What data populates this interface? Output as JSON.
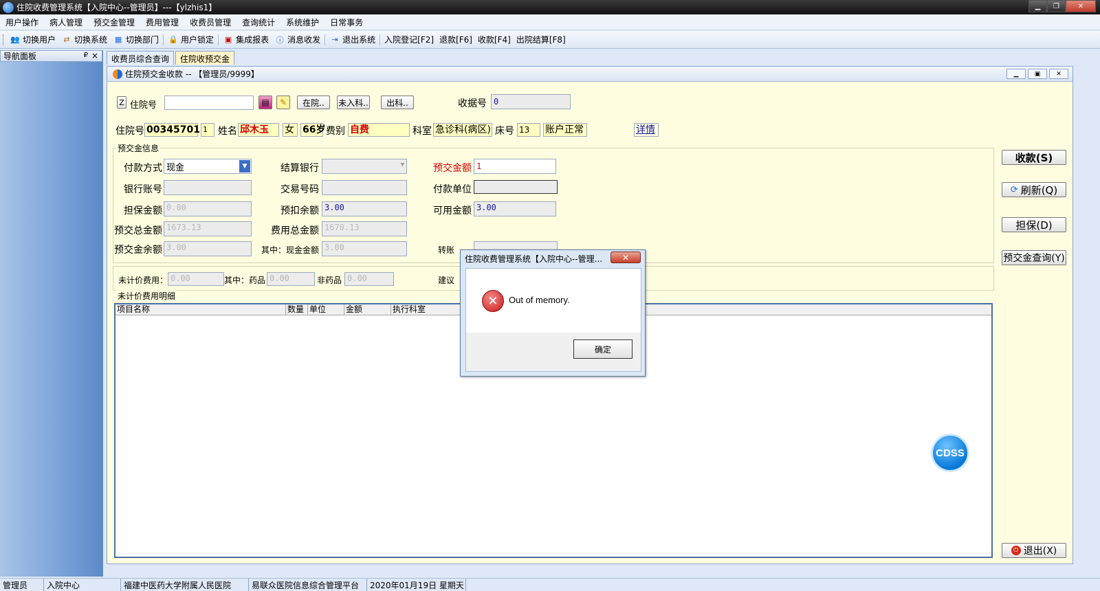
{
  "window": {
    "title": "住院收费管理系统【入院中心--管理员】---【ylzhis1】"
  },
  "menu": [
    "用户操作",
    "病人管理",
    "预交金管理",
    "费用管理",
    "收费员管理",
    "查询统计",
    "系统维护",
    "日常事务"
  ],
  "toolbar": {
    "switch_user": "切换用户",
    "switch_system": "切换系统",
    "switch_dept": "切换部门",
    "user_lock": "用户锁定",
    "integrated_report": "集成报表",
    "message": "消息收发",
    "exit_system": "退出系统",
    "admission": "入院登记[F2]",
    "refund": "退款[F6]",
    "charge": "收款[F4]",
    "discharge": "出院结算[F8]"
  },
  "nav": {
    "title": "导航面板",
    "pin": "₽",
    "close": "×"
  },
  "tabs": [
    "收费员综合查询",
    "住院收预交金"
  ],
  "form": {
    "title": "住院预交金收款 -- 【管理员/9999】",
    "z_label": "Z",
    "inpatient_no_label": "住院号",
    "inpatient_no_value": "",
    "btn_in_hospital": "在院..",
    "btn_not_admitted": "未入科..",
    "btn_discharged": "出科..",
    "receipt_label": "收据号",
    "receipt_value": "0",
    "patient": {
      "id_label": "住院号",
      "id": "00345701",
      "seq": "1",
      "name_label": "姓名",
      "name": "邱木玉",
      "gender": "女",
      "age": "66岁",
      "fee_type_label": "费别",
      "fee_type": "自费",
      "dept_label": "科室",
      "dept": "急诊科(病区)",
      "bed_label": "床号",
      "bed": "13",
      "account_status": "账户正常",
      "detail_link": "详情"
    },
    "deposit_group": "预交金信息",
    "pay_method_label": "付款方式",
    "pay_method": "现金",
    "settle_bank_label": "结算银行",
    "settle_bank": "",
    "deposit_amount_label": "预交金额",
    "deposit_amount": "1",
    "bank_account_label": "银行账号",
    "bank_account": "",
    "trade_no_label": "交易号码",
    "trade_no": "",
    "payer_unit_label": "付款单位",
    "payer_unit": "",
    "guarantee_label": "担保金额",
    "guarantee": "0.00",
    "pre_deduct_label": "预扣余额",
    "pre_deduct": "3.00",
    "available_label": "可用金额",
    "available": "3.00",
    "deposit_total_label": "预交总金额",
    "deposit_total": "1673.13",
    "fee_total_label": "费用总金额",
    "fee_total": "1670.13",
    "deposit_balance_label": "预交金余额",
    "deposit_balance": "3.00",
    "cash_amount_label": "其中：现金金额",
    "cash_amount": "3.00",
    "transfer_label": "转账",
    "unbilled_label": "未计价费用：",
    "unbilled": "0.00",
    "drug_label": "其中：药品",
    "drug": "0.00",
    "non_drug_label": "非药品",
    "non_drug": "0.00",
    "suggest_label": "建议",
    "unbilled_detail_group": "未计价费用明细",
    "grid_columns": [
      "项目名称",
      "数量",
      "单位",
      "金额",
      "执行科室"
    ],
    "side_buttons": {
      "charge": "收款(S)",
      "refresh": "刷新(Q)",
      "guarantee": "担保(D)",
      "query": "预交金查询(Y)",
      "exit": "退出(X)"
    },
    "cdss": "CDSS"
  },
  "dialog": {
    "title": "住院收费管理系统【入院中心--管理...",
    "message": "Out of memory.",
    "ok": "确定",
    "close": "✕"
  },
  "status": [
    "管理员",
    "入院中心",
    "福建中医药大学附属人民医院",
    "易联众医院信息综合管理平台",
    "2020年01月19日 星期天"
  ]
}
